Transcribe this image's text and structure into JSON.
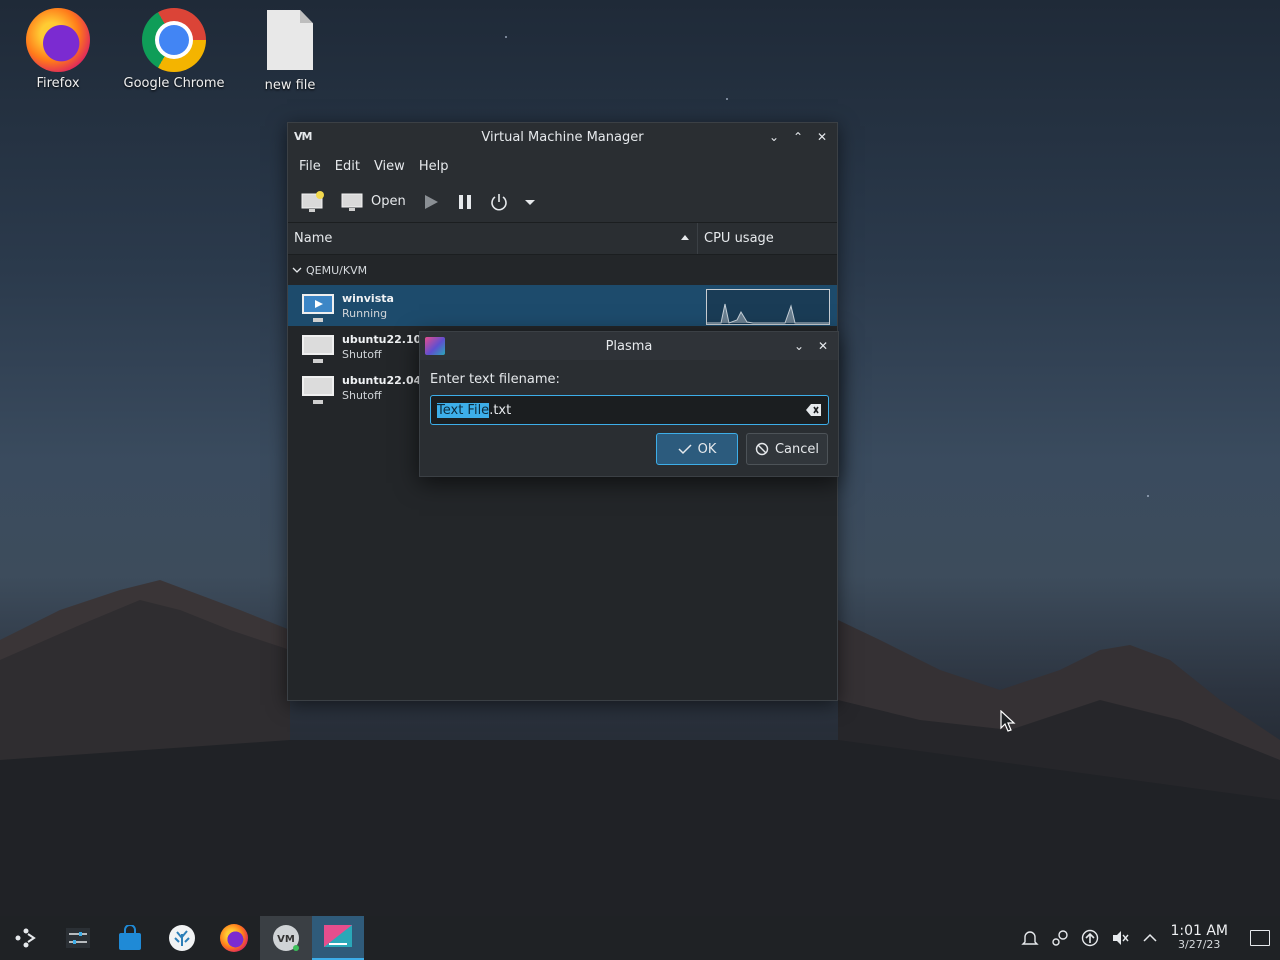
{
  "desktop": {
    "icons": [
      {
        "label": "Firefox",
        "icon": "firefox-icon"
      },
      {
        "label": "Google Chrome",
        "icon": "chrome-icon"
      },
      {
        "label": "new file",
        "icon": "file-icon"
      }
    ]
  },
  "vmm": {
    "title": "Virtual Machine Manager",
    "logo_text": "VM",
    "menu": [
      "File",
      "Edit",
      "View",
      "Help"
    ],
    "toolbar": {
      "open_label": "Open"
    },
    "columns": {
      "name": "Name",
      "cpu": "CPU usage"
    },
    "group": "QEMU/KVM",
    "vms": [
      {
        "name": "winvista",
        "state": "Running",
        "selected": true
      },
      {
        "name": "ubuntu22.10",
        "state": "Shutoff",
        "selected": false
      },
      {
        "name": "ubuntu22.04",
        "state": "Shutoff",
        "selected": false
      }
    ]
  },
  "dialog": {
    "title": "Plasma",
    "label": "Enter text filename:",
    "input_selected": "Text File",
    "input_rest": ".txt",
    "ok_label": "OK",
    "cancel_label": "Cancel"
  },
  "taskbar": {
    "time": "1:01 AM",
    "date": "3/27/23"
  },
  "colors": {
    "accent": "#3daee9",
    "selection": "#1d4b6c",
    "window_bg": "#232629"
  }
}
